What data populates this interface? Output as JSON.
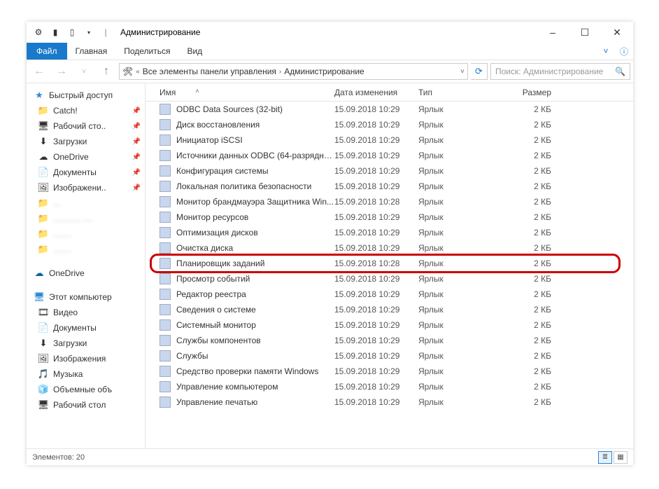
{
  "window": {
    "title": "Администрирование",
    "minimize": "–",
    "maximize": "☐",
    "close": "✕"
  },
  "ribbon": {
    "file": "Файл",
    "tabs": [
      "Главная",
      "Поделиться",
      "Вид"
    ]
  },
  "address": {
    "nav_back": "←",
    "nav_fwd": "→",
    "nav_up": "↑",
    "crumbs": [
      "Все элементы панели управления",
      "Администрирование"
    ],
    "search_placeholder": "Поиск: Администрирование"
  },
  "sidebar": {
    "quick_access": {
      "label": "Быстрый доступ",
      "items": [
        {
          "label": "Catch!",
          "icon": "📁",
          "pinned": true
        },
        {
          "label": "Рабочий сто..",
          "icon": "🖥",
          "pinned": true
        },
        {
          "label": "Загрузки",
          "icon": "⬇",
          "pinned": true
        },
        {
          "label": "OneDrive",
          "icon": "☁",
          "pinned": true
        },
        {
          "label": "Документы",
          "icon": "📄",
          "pinned": true
        },
        {
          "label": "Изображени..",
          "icon": "🖼",
          "pinned": true
        },
        {
          "label": "...",
          "icon": "📁",
          "blurred": true
        },
        {
          "label": "............ ....",
          "icon": "📁",
          "blurred": true
        },
        {
          "label": "........",
          "icon": "📁",
          "blurred": true
        },
        {
          "label": "........",
          "icon": "📁",
          "blurred": true
        }
      ]
    },
    "onedrive": {
      "label": "OneDrive",
      "icon": "☁"
    },
    "this_pc": {
      "label": "Этот компьютер",
      "items": [
        {
          "label": "Видео",
          "icon": "🎞"
        },
        {
          "label": "Документы",
          "icon": "📄"
        },
        {
          "label": "Загрузки",
          "icon": "⬇"
        },
        {
          "label": "Изображения",
          "icon": "🖼"
        },
        {
          "label": "Музыка",
          "icon": "🎵"
        },
        {
          "label": "Объемные объ",
          "icon": "🧊"
        },
        {
          "label": "Рабочий стол",
          "icon": "🖥"
        }
      ]
    }
  },
  "columns": {
    "name": "Имя",
    "date": "Дата изменения",
    "type": "Тип",
    "size": "Размер"
  },
  "files": [
    {
      "name": "ODBC Data Sources (32-bit)",
      "date": "15.09.2018 10:29",
      "type": "Ярлык",
      "size": "2 КБ"
    },
    {
      "name": "Диск восстановления",
      "date": "15.09.2018 10:29",
      "type": "Ярлык",
      "size": "2 КБ"
    },
    {
      "name": "Инициатор iSCSI",
      "date": "15.09.2018 10:29",
      "type": "Ярлык",
      "size": "2 КБ"
    },
    {
      "name": "Источники данных ODBC (64-разрядна...",
      "date": "15.09.2018 10:29",
      "type": "Ярлык",
      "size": "2 КБ"
    },
    {
      "name": "Конфигурация системы",
      "date": "15.09.2018 10:29",
      "type": "Ярлык",
      "size": "2 КБ"
    },
    {
      "name": "Локальная политика безопасности",
      "date": "15.09.2018 10:29",
      "type": "Ярлык",
      "size": "2 КБ"
    },
    {
      "name": "Монитор брандмауэра Защитника Win...",
      "date": "15.09.2018 10:28",
      "type": "Ярлык",
      "size": "2 КБ"
    },
    {
      "name": "Монитор ресурсов",
      "date": "15.09.2018 10:29",
      "type": "Ярлык",
      "size": "2 КБ"
    },
    {
      "name": "Оптимизация дисков",
      "date": "15.09.2018 10:29",
      "type": "Ярлык",
      "size": "2 КБ"
    },
    {
      "name": "Очистка диска",
      "date": "15.09.2018 10:29",
      "type": "Ярлык",
      "size": "2 КБ"
    },
    {
      "name": "Планировщик заданий",
      "date": "15.09.2018 10:28",
      "type": "Ярлык",
      "size": "2 КБ",
      "highlight": true
    },
    {
      "name": "Просмотр событий",
      "date": "15.09.2018 10:29",
      "type": "Ярлык",
      "size": "2 КБ"
    },
    {
      "name": "Редактор реестра",
      "date": "15.09.2018 10:29",
      "type": "Ярлык",
      "size": "2 КБ"
    },
    {
      "name": "Сведения о системе",
      "date": "15.09.2018 10:29",
      "type": "Ярлык",
      "size": "2 КБ"
    },
    {
      "name": "Системный монитор",
      "date": "15.09.2018 10:29",
      "type": "Ярлык",
      "size": "2 КБ"
    },
    {
      "name": "Службы компонентов",
      "date": "15.09.2018 10:29",
      "type": "Ярлык",
      "size": "2 КБ"
    },
    {
      "name": "Службы",
      "date": "15.09.2018 10:29",
      "type": "Ярлык",
      "size": "2 КБ"
    },
    {
      "name": "Средство проверки памяти Windows",
      "date": "15.09.2018 10:29",
      "type": "Ярлык",
      "size": "2 КБ"
    },
    {
      "name": "Управление компьютером",
      "date": "15.09.2018 10:29",
      "type": "Ярлык",
      "size": "2 КБ"
    },
    {
      "name": "Управление печатью",
      "date": "15.09.2018 10:29",
      "type": "Ярлык",
      "size": "2 КБ"
    }
  ],
  "status": {
    "text": "Элементов: 20"
  }
}
